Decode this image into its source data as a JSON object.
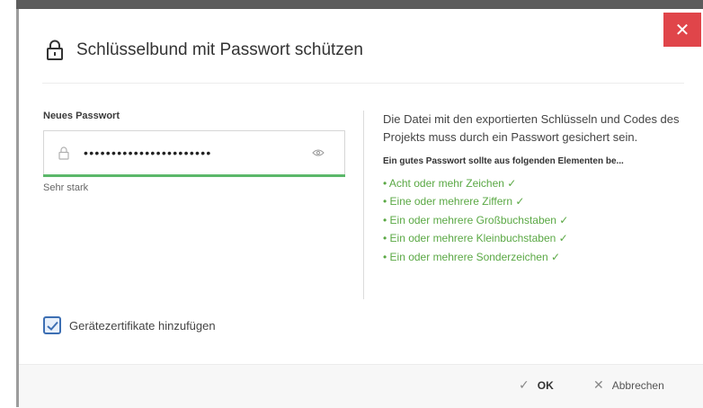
{
  "dialog": {
    "title": "Schlüsselbund mit Passwort schützen",
    "close_glyph": "✕"
  },
  "password": {
    "label": "Neues Passwort",
    "value": "•••••••••••••••••••••••",
    "strength_text": "Sehr stark",
    "strength_fraction": 1.0
  },
  "info": {
    "description": "Die Datei mit den exportierten Schlüsseln und Codes des Projekts muss durch ein Passwort gesichert sein.",
    "rules_heading": "Ein gutes Passwort sollte aus folgenden Elementen be...",
    "rules": [
      "• Acht oder mehr Zeichen ✓",
      "• Eine oder mehrere Ziffern ✓",
      "• Ein oder mehrere Großbuchstaben ✓",
      "• Ein oder mehrere Kleinbuchstaben ✓",
      "• Ein oder mehrere Sonderzeichen ✓"
    ]
  },
  "options": {
    "device_certs_label": "Gerätezertifikate hinzufügen",
    "device_certs_checked": true
  },
  "buttons": {
    "ok_icon": "✓",
    "ok_label": "OK",
    "cancel_icon": "✕",
    "cancel_label": "Abbrechen"
  },
  "colors": {
    "close_button": "#e0454a",
    "strength_bar": "#5bb86a",
    "rule_text": "#5aa844",
    "checkbox_border": "#3d6fb3"
  },
  "icons": {
    "title_icon": "lock-icon",
    "field_icon": "lock-icon",
    "reveal_icon": "eye-icon",
    "checkbox_icon": "checkmark-icon"
  }
}
